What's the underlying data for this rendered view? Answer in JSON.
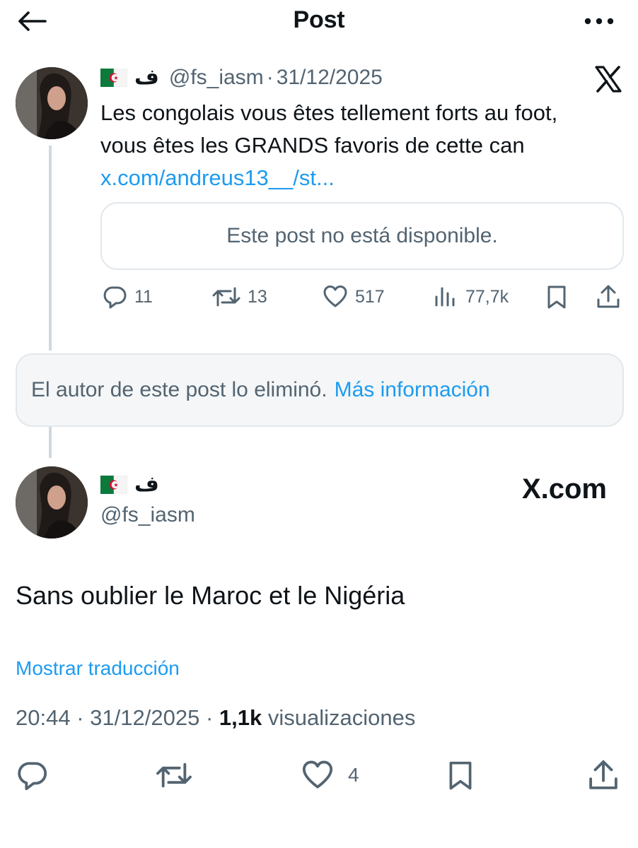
{
  "header": {
    "title": "Post"
  },
  "quoted_tweet": {
    "display_name": "ف",
    "handle": "@fs_iasm",
    "separator": "·",
    "date": "31/12/2025",
    "text_line1": "Les congolais vous êtes tellement forts au foot,",
    "text_line2": "vous êtes les GRANDS favoris de cette can",
    "link_text": "x.com/andreus13__/st...",
    "unavailable_card_text": "Este post no está disponible.",
    "stats": {
      "replies": "11",
      "reposts": "13",
      "likes": "517",
      "views": "77,7k"
    }
  },
  "deleted_notice": {
    "text": "El autor de este post lo eliminó.",
    "link": "Más información"
  },
  "main_tweet": {
    "display_name": "ف",
    "handle": "@fs_iasm",
    "watermark": "X.com",
    "text": "Sans oublier le Maroc et le Nigéria",
    "translate_link": "Mostrar traducción",
    "time": "20:44",
    "separator": "·",
    "date": "31/12/2025",
    "views_count": "1,1k",
    "views_label": "visualizaciones",
    "likes": "4"
  },
  "colors": {
    "accent": "#1d9bf0",
    "muted": "#536471",
    "text": "#0f1419",
    "border": "#e1e8ed"
  },
  "icons": {
    "back": "arrow-left-icon",
    "more": "more-horizontal-icon",
    "x_logo": "x-logo-icon",
    "reply": "reply-icon",
    "repost": "repost-icon",
    "like": "heart-icon",
    "views": "views-chart-icon",
    "bookmark": "bookmark-icon",
    "share": "share-icon",
    "flag": "algeria-flag-icon"
  }
}
